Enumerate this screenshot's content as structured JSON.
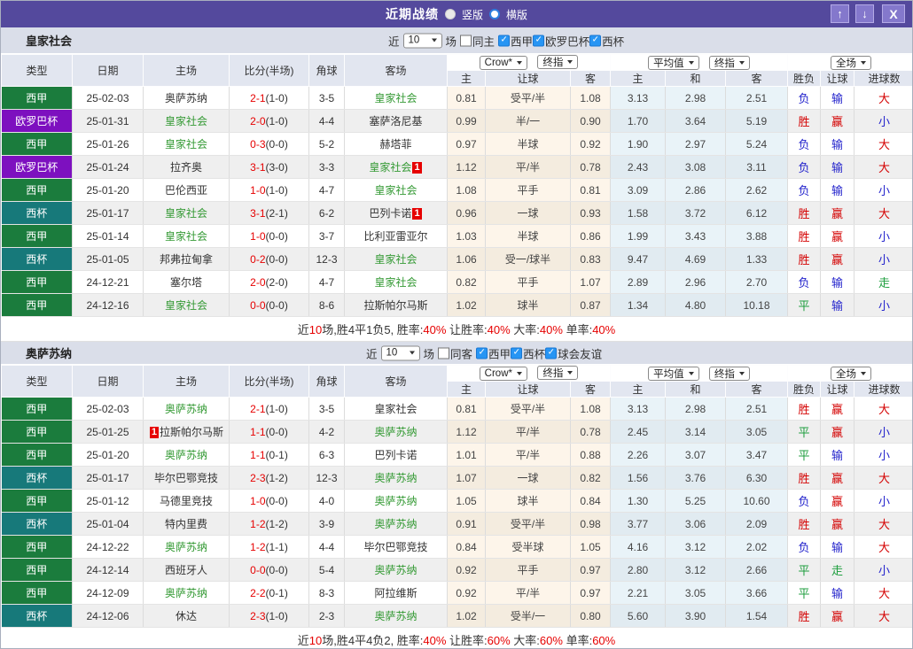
{
  "colors": {
    "titlebar_bg": "#54499D",
    "section_head_bg": "#DADEE9",
    "header_cell_bg": "#E2E6F0",
    "odds_bg": "#FDF5EA",
    "avg_bg": "#E9F3F8",
    "team_green": "#339933",
    "score_red": "#E60000",
    "win_red": "#D40000",
    "lose_blue": "#2323CC",
    "draw_green": "#1E9E3E",
    "checkbox_blue": "#2795F4",
    "type_colors": {
      "西甲": "#1B7C3D",
      "欧罗巴杯": "#7D10BF",
      "西杯": "#17797A"
    }
  },
  "titlebar": {
    "title": "近期战绩",
    "radio_vertical": "竖版",
    "radio_horizontal": "横版"
  },
  "window_buttons": {
    "up": "↑",
    "down": "↓",
    "close": "X"
  },
  "labels": {
    "recent": "近",
    "games": "10",
    "matches": "场"
  },
  "header": {
    "type": "类型",
    "date": "日期",
    "home": "主场",
    "score": "比分(半场)",
    "corner": "角球",
    "away": "客场",
    "crow": "Crow*",
    "final": "终指",
    "average": "平均值",
    "final2": "终指",
    "full": "全场",
    "h_home": "主",
    "h_handicap": "让球",
    "h_away": "客",
    "a_home": "主",
    "a_draw": "和",
    "a_away": "客",
    "r_winlose": "胜负",
    "r_handicap": "让球",
    "r_goals": "进球数"
  },
  "sections": [
    {
      "team": "皇家社会",
      "same_label": "同主",
      "filters": [
        "西甲",
        "欧罗巴杯",
        "西杯"
      ],
      "rows": [
        {
          "type": "西甲",
          "date": "25-02-03",
          "home": "奥萨苏纳",
          "home_green": false,
          "home_badge": "",
          "home_badge_pos": "after",
          "score": "2-1",
          "half": "(1-0)",
          "corner": "3-5",
          "away": "皇家社会",
          "away_green": true,
          "away_badge": "",
          "away_badge_pos": "after",
          "odds": [
            "0.81",
            "受平/半",
            "1.08"
          ],
          "avg": [
            "3.13",
            "2.98",
            "2.51"
          ],
          "results": [
            "负",
            "输",
            "大"
          ]
        },
        {
          "type": "欧罗巴杯",
          "date": "25-01-31",
          "home": "皇家社会",
          "home_green": true,
          "home_badge": "",
          "home_badge_pos": "after",
          "score": "2-0",
          "half": "(1-0)",
          "corner": "4-4",
          "away": "塞萨洛尼基",
          "away_green": false,
          "away_badge": "",
          "away_badge_pos": "after",
          "odds": [
            "0.99",
            "半/一",
            "0.90"
          ],
          "avg": [
            "1.70",
            "3.64",
            "5.19"
          ],
          "results": [
            "胜",
            "赢",
            "小"
          ]
        },
        {
          "type": "西甲",
          "date": "25-01-26",
          "home": "皇家社会",
          "home_green": true,
          "home_badge": "",
          "home_badge_pos": "after",
          "score": "0-3",
          "half": "(0-0)",
          "corner": "5-2",
          "away": "赫塔菲",
          "away_green": false,
          "away_badge": "",
          "away_badge_pos": "after",
          "odds": [
            "0.97",
            "半球",
            "0.92"
          ],
          "avg": [
            "1.90",
            "2.97",
            "5.24"
          ],
          "results": [
            "负",
            "输",
            "大"
          ]
        },
        {
          "type": "欧罗巴杯",
          "date": "25-01-24",
          "home": "拉齐奥",
          "home_green": false,
          "home_badge": "",
          "home_badge_pos": "after",
          "score": "3-1",
          "half": "(3-0)",
          "corner": "3-3",
          "away": "皇家社会",
          "away_green": true,
          "away_badge": "1",
          "away_badge_pos": "after",
          "odds": [
            "1.12",
            "平/半",
            "0.78"
          ],
          "avg": [
            "2.43",
            "3.08",
            "3.11"
          ],
          "results": [
            "负",
            "输",
            "大"
          ]
        },
        {
          "type": "西甲",
          "date": "25-01-20",
          "home": "巴伦西亚",
          "home_green": false,
          "home_badge": "",
          "home_badge_pos": "after",
          "score": "1-0",
          "half": "(1-0)",
          "corner": "4-7",
          "away": "皇家社会",
          "away_green": true,
          "away_badge": "",
          "away_badge_pos": "after",
          "odds": [
            "1.08",
            "平手",
            "0.81"
          ],
          "avg": [
            "3.09",
            "2.86",
            "2.62"
          ],
          "results": [
            "负",
            "输",
            "小"
          ]
        },
        {
          "type": "西杯",
          "date": "25-01-17",
          "home": "皇家社会",
          "home_green": true,
          "home_badge": "",
          "home_badge_pos": "after",
          "score": "3-1",
          "half": "(2-1)",
          "corner": "6-2",
          "away": "巴列卡诺",
          "away_green": false,
          "away_badge": "1",
          "away_badge_pos": "after",
          "odds": [
            "0.96",
            "一球",
            "0.93"
          ],
          "avg": [
            "1.58",
            "3.72",
            "6.12"
          ],
          "results": [
            "胜",
            "赢",
            "大"
          ]
        },
        {
          "type": "西甲",
          "date": "25-01-14",
          "home": "皇家社会",
          "home_green": true,
          "home_badge": "",
          "home_badge_pos": "after",
          "score": "1-0",
          "half": "(0-0)",
          "corner": "3-7",
          "away": "比利亚雷亚尔",
          "away_green": false,
          "away_badge": "",
          "away_badge_pos": "after",
          "odds": [
            "1.03",
            "半球",
            "0.86"
          ],
          "avg": [
            "1.99",
            "3.43",
            "3.88"
          ],
          "results": [
            "胜",
            "赢",
            "小"
          ]
        },
        {
          "type": "西杯",
          "date": "25-01-05",
          "home": "邦弗拉甸拿",
          "home_green": false,
          "home_badge": "",
          "home_badge_pos": "after",
          "score": "0-2",
          "half": "(0-0)",
          "corner": "12-3",
          "away": "皇家社会",
          "away_green": true,
          "away_badge": "",
          "away_badge_pos": "after",
          "odds": [
            "1.06",
            "受一/球半",
            "0.83"
          ],
          "avg": [
            "9.47",
            "4.69",
            "1.33"
          ],
          "results": [
            "胜",
            "赢",
            "小"
          ]
        },
        {
          "type": "西甲",
          "date": "24-12-21",
          "home": "塞尔塔",
          "home_green": false,
          "home_badge": "",
          "home_badge_pos": "after",
          "score": "2-0",
          "half": "(2-0)",
          "corner": "4-7",
          "away": "皇家社会",
          "away_green": true,
          "away_badge": "",
          "away_badge_pos": "after",
          "odds": [
            "0.82",
            "平手",
            "1.07"
          ],
          "avg": [
            "2.89",
            "2.96",
            "2.70"
          ],
          "results": [
            "负",
            "输",
            "走"
          ]
        },
        {
          "type": "西甲",
          "date": "24-12-16",
          "home": "皇家社会",
          "home_green": true,
          "home_badge": "",
          "home_badge_pos": "after",
          "score": "0-0",
          "half": "(0-0)",
          "corner": "8-6",
          "away": "拉斯帕尔马斯",
          "away_green": false,
          "away_badge": "",
          "away_badge_pos": "after",
          "odds": [
            "1.02",
            "球半",
            "0.87"
          ],
          "avg": [
            "1.34",
            "4.80",
            "10.18"
          ],
          "results": [
            "平",
            "输",
            "小"
          ]
        }
      ],
      "summary": [
        [
          "近",
          "d"
        ],
        [
          "10",
          "r"
        ],
        [
          "场,胜4平1负5, 胜率:",
          "d"
        ],
        [
          "40%",
          "r"
        ],
        [
          " 让胜率:",
          "d"
        ],
        [
          "40%",
          "r"
        ],
        [
          " 大率:",
          "d"
        ],
        [
          "40%",
          "r"
        ],
        [
          " 单率:",
          "d"
        ],
        [
          "40%",
          "r"
        ]
      ]
    },
    {
      "team": "奥萨苏纳",
      "same_label": "同客",
      "filters": [
        "西甲",
        "西杯",
        "球会友谊"
      ],
      "rows": [
        {
          "type": "西甲",
          "date": "25-02-03",
          "home": "奥萨苏纳",
          "home_green": true,
          "home_badge": "",
          "home_badge_pos": "after",
          "score": "2-1",
          "half": "(1-0)",
          "corner": "3-5",
          "away": "皇家社会",
          "away_green": false,
          "away_badge": "",
          "away_badge_pos": "after",
          "odds": [
            "0.81",
            "受平/半",
            "1.08"
          ],
          "avg": [
            "3.13",
            "2.98",
            "2.51"
          ],
          "results": [
            "胜",
            "赢",
            "大"
          ]
        },
        {
          "type": "西甲",
          "date": "25-01-25",
          "home": "拉斯帕尔马斯",
          "home_green": false,
          "home_badge": "1",
          "home_badge_pos": "before",
          "score": "1-1",
          "half": "(0-0)",
          "corner": "4-2",
          "away": "奥萨苏纳",
          "away_green": true,
          "away_badge": "",
          "away_badge_pos": "after",
          "odds": [
            "1.12",
            "平/半",
            "0.78"
          ],
          "avg": [
            "2.45",
            "3.14",
            "3.05"
          ],
          "results": [
            "平",
            "赢",
            "小"
          ]
        },
        {
          "type": "西甲",
          "date": "25-01-20",
          "home": "奥萨苏纳",
          "home_green": true,
          "home_badge": "",
          "home_badge_pos": "after",
          "score": "1-1",
          "half": "(0-1)",
          "corner": "6-3",
          "away": "巴列卡诺",
          "away_green": false,
          "away_badge": "",
          "away_badge_pos": "after",
          "odds": [
            "1.01",
            "平/半",
            "0.88"
          ],
          "avg": [
            "2.26",
            "3.07",
            "3.47"
          ],
          "results": [
            "平",
            "输",
            "小"
          ]
        },
        {
          "type": "西杯",
          "date": "25-01-17",
          "home": "毕尔巴鄂竞技",
          "home_green": false,
          "home_badge": "",
          "home_badge_pos": "after",
          "score": "2-3",
          "half": "(1-2)",
          "corner": "12-3",
          "away": "奥萨苏纳",
          "away_green": true,
          "away_badge": "",
          "away_badge_pos": "after",
          "odds": [
            "1.07",
            "一球",
            "0.82"
          ],
          "avg": [
            "1.56",
            "3.76",
            "6.30"
          ],
          "results": [
            "胜",
            "赢",
            "大"
          ]
        },
        {
          "type": "西甲",
          "date": "25-01-12",
          "home": "马德里竞技",
          "home_green": false,
          "home_badge": "",
          "home_badge_pos": "after",
          "score": "1-0",
          "half": "(0-0)",
          "corner": "4-0",
          "away": "奥萨苏纳",
          "away_green": true,
          "away_badge": "",
          "away_badge_pos": "after",
          "odds": [
            "1.05",
            "球半",
            "0.84"
          ],
          "avg": [
            "1.30",
            "5.25",
            "10.60"
          ],
          "results": [
            "负",
            "赢",
            "小"
          ]
        },
        {
          "type": "西杯",
          "date": "25-01-04",
          "home": "特内里费",
          "home_green": false,
          "home_badge": "",
          "home_badge_pos": "after",
          "score": "1-2",
          "half": "(1-2)",
          "corner": "3-9",
          "away": "奥萨苏纳",
          "away_green": true,
          "away_badge": "",
          "away_badge_pos": "after",
          "odds": [
            "0.91",
            "受平/半",
            "0.98"
          ],
          "avg": [
            "3.77",
            "3.06",
            "2.09"
          ],
          "results": [
            "胜",
            "赢",
            "大"
          ]
        },
        {
          "type": "西甲",
          "date": "24-12-22",
          "home": "奥萨苏纳",
          "home_green": true,
          "home_badge": "",
          "home_badge_pos": "after",
          "score": "1-2",
          "half": "(1-1)",
          "corner": "4-4",
          "away": "毕尔巴鄂竞技",
          "away_green": false,
          "away_badge": "",
          "away_badge_pos": "after",
          "odds": [
            "0.84",
            "受半球",
            "1.05"
          ],
          "avg": [
            "4.16",
            "3.12",
            "2.02"
          ],
          "results": [
            "负",
            "输",
            "大"
          ]
        },
        {
          "type": "西甲",
          "date": "24-12-14",
          "home": "西班牙人",
          "home_green": false,
          "home_badge": "",
          "home_badge_pos": "after",
          "score": "0-0",
          "half": "(0-0)",
          "corner": "5-4",
          "away": "奥萨苏纳",
          "away_green": true,
          "away_badge": "",
          "away_badge_pos": "after",
          "odds": [
            "0.92",
            "平手",
            "0.97"
          ],
          "avg": [
            "2.80",
            "3.12",
            "2.66"
          ],
          "results": [
            "平",
            "走",
            "小"
          ]
        },
        {
          "type": "西甲",
          "date": "24-12-09",
          "home": "奥萨苏纳",
          "home_green": true,
          "home_badge": "",
          "home_badge_pos": "after",
          "score": "2-2",
          "half": "(0-1)",
          "corner": "8-3",
          "away": "阿拉维斯",
          "away_green": false,
          "away_badge": "",
          "away_badge_pos": "after",
          "odds": [
            "0.92",
            "平/半",
            "0.97"
          ],
          "avg": [
            "2.21",
            "3.05",
            "3.66"
          ],
          "results": [
            "平",
            "输",
            "大"
          ]
        },
        {
          "type": "西杯",
          "date": "24-12-06",
          "home": "休达",
          "home_green": false,
          "home_badge": "",
          "home_badge_pos": "after",
          "score": "2-3",
          "half": "(1-0)",
          "corner": "2-3",
          "away": "奥萨苏纳",
          "away_green": true,
          "away_badge": "",
          "away_badge_pos": "after",
          "odds": [
            "1.02",
            "受半/一",
            "0.80"
          ],
          "avg": [
            "5.60",
            "3.90",
            "1.54"
          ],
          "results": [
            "胜",
            "赢",
            "大"
          ]
        }
      ],
      "summary": [
        [
          "近",
          "d"
        ],
        [
          "10",
          "r"
        ],
        [
          "场,胜4平4负2, 胜率:",
          "d"
        ],
        [
          "40%",
          "r"
        ],
        [
          " 让胜率:",
          "d"
        ],
        [
          "60%",
          "r"
        ],
        [
          " 大率:",
          "d"
        ],
        [
          "60%",
          "r"
        ],
        [
          " 单率:",
          "d"
        ],
        [
          "60%",
          "r"
        ]
      ]
    }
  ]
}
